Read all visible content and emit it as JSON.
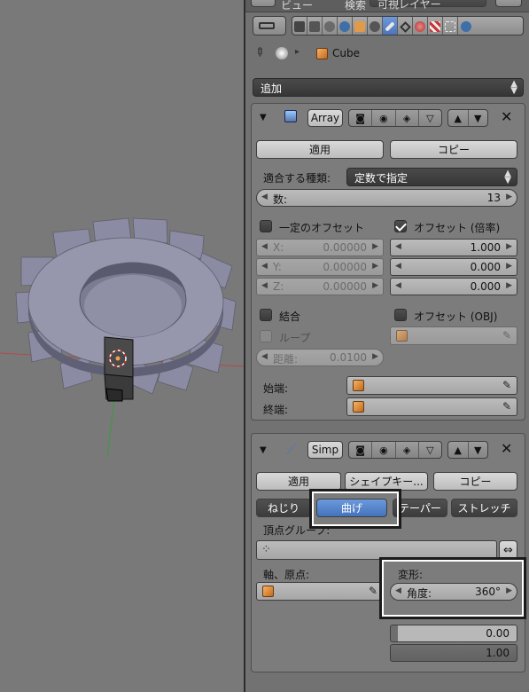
{
  "header": {
    "view_menu": "ビュー",
    "search_menu": "検索",
    "layer_menu": "可視レイヤー"
  },
  "properties": {
    "breadcrumb": {
      "object_name": "Cube"
    },
    "add_modifier_dropdown": "追加",
    "array_modifier": {
      "name": "Array",
      "apply_label": "適用",
      "copy_label": "コピー",
      "fit_type_label": "適合する種類:",
      "fit_type_value": "定数で指定",
      "count_label": "数:",
      "count_value": "13",
      "constant_offset_label": "一定のオフセット",
      "constant_offset_checked": false,
      "relative_offset_label": "オフセット (倍率)",
      "relative_offset_checked": true,
      "constant_offset": [
        {
          "label": "X:",
          "value": "0.00000"
        },
        {
          "label": "Y:",
          "value": "0.00000"
        },
        {
          "label": "Z:",
          "value": "0.00000"
        }
      ],
      "relative_offset": [
        "1.000",
        "0.000",
        "0.000"
      ],
      "merge_label": "結合",
      "object_offset_label": "オフセット (OBJ)",
      "loop_label": "ループ",
      "distance_label": "距離:",
      "distance_value": "0.0100",
      "start_cap_label": "始端:",
      "end_cap_label": "終端:"
    },
    "simple_deform_modifier": {
      "name": "Simp",
      "apply_label": "適用",
      "shapekey_label": "シェイプキー...",
      "copy_label": "コピー",
      "modes": [
        "ねじり",
        "曲げ",
        "テーパー",
        "ストレッチ"
      ],
      "active_mode": "曲げ",
      "vertex_group_label": "頂点グループ:",
      "axis_origin_label": "軸、原点:",
      "deform_label": "変形:",
      "angle_label": "角度:",
      "angle_value": "360°",
      "limits": [
        "0.00",
        "1.00"
      ]
    }
  },
  "colors": {
    "active_blue": "#4a78c0",
    "panel_bg": "#727272",
    "viewport_bg": "#797979"
  }
}
